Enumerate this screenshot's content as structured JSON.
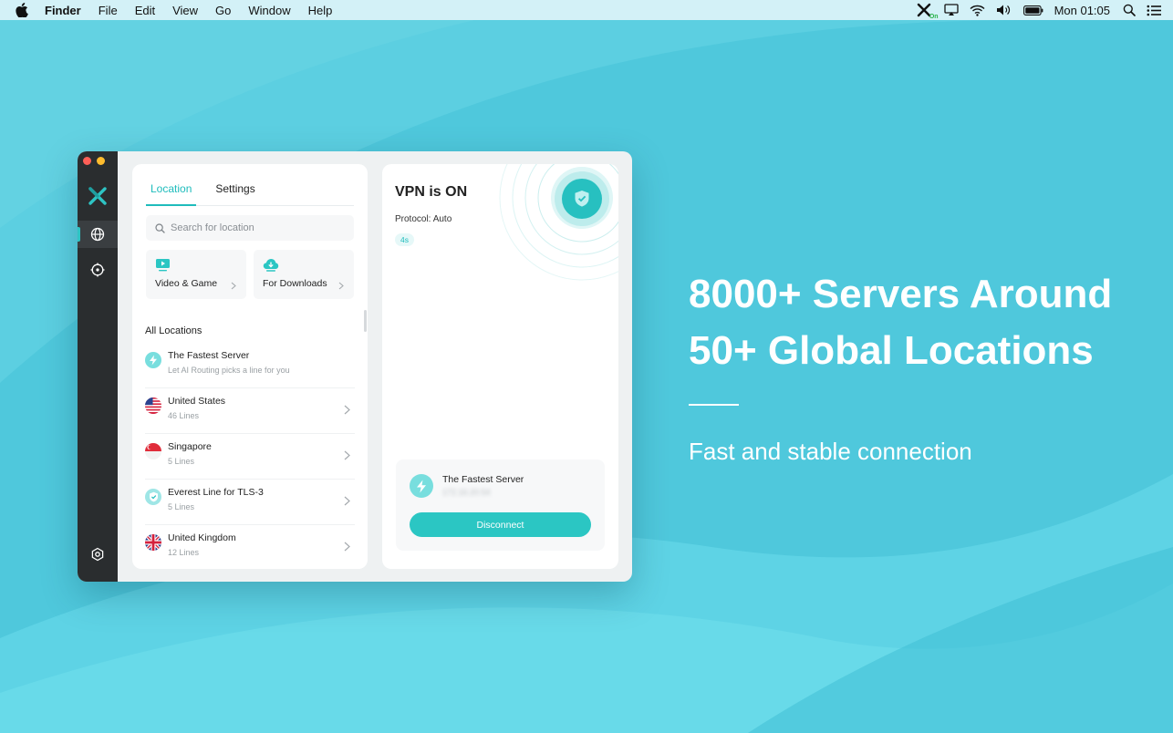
{
  "menubar": {
    "app_name": "Finder",
    "menus": [
      "File",
      "Edit",
      "View",
      "Go",
      "Window",
      "Help"
    ],
    "clock": "Mon 01:05",
    "vpn_tray_badge": "On",
    "tray_icons": [
      "vpn-icon",
      "airplay-icon",
      "wifi-icon",
      "volume-icon",
      "battery-icon",
      "spotlight-icon",
      "control-center-icon"
    ]
  },
  "app": {
    "tabs": {
      "location": "Location",
      "settings": "Settings"
    },
    "search": {
      "placeholder": "Search for location"
    },
    "quick": {
      "video_game": "Video & Game",
      "downloads": "For Downloads"
    },
    "section_title": "All Locations",
    "locations": [
      {
        "name": "The Fastest Server",
        "sub": "Let AI Routing picks a line for you",
        "flag": "bolt"
      },
      {
        "name": "United States",
        "sub": "46 Lines",
        "flag": "us"
      },
      {
        "name": "Singapore",
        "sub": "5 Lines",
        "flag": "sg"
      },
      {
        "name": "Everest Line for TLS-3",
        "sub": "5 Lines",
        "flag": "shield"
      },
      {
        "name": "United Kingdom",
        "sub": "12 Lines",
        "flag": "uk"
      }
    ],
    "status": {
      "title": "VPN is ON",
      "protocol": "Protocol: Auto",
      "timer": "4s"
    },
    "server_card": {
      "name": "The Fastest Server",
      "ip_blurred": "172.16.20.54",
      "disconnect": "Disconnect"
    },
    "accent": "#2bc6c3"
  },
  "promo": {
    "line1": "8000+ Servers Around",
    "line2": "50+ Global Locations",
    "tagline": "Fast and stable connection"
  }
}
